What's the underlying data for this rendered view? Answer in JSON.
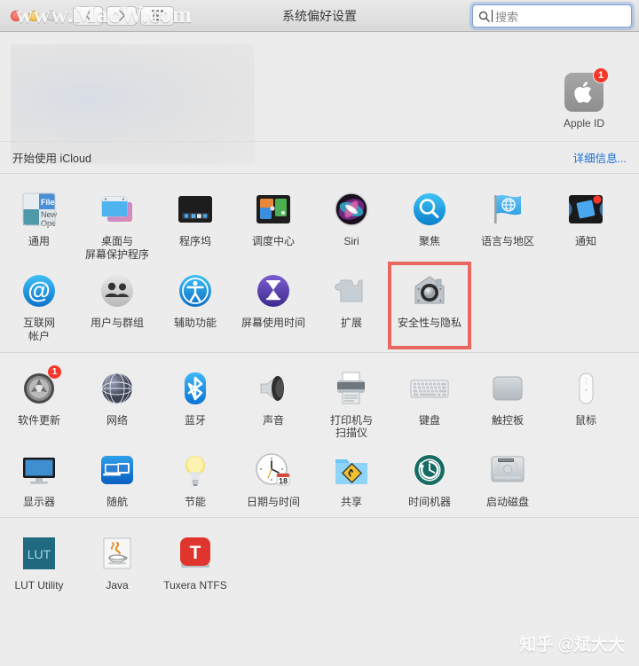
{
  "window": {
    "title": "系统偏好设置",
    "traffic_lights": [
      "close",
      "minimize",
      "zoom"
    ],
    "nav": {
      "back": "‹",
      "forward": "›",
      "show_all": "show-all-grid"
    }
  },
  "search": {
    "placeholder": "搜索",
    "value": "",
    "icon": "search-icon"
  },
  "watermarks": {
    "top": "www.MacW.com",
    "bottom": "知乎 @斌大大"
  },
  "icloud_banner": {
    "start_text": "开始使用 iCloud",
    "details_link": "详细信息...",
    "apple_id": {
      "label": "Apple ID",
      "badge": "1",
      "icon": "apple-logo-icon"
    }
  },
  "accent_colors": {
    "highlight_box": "#e8685f",
    "badge_red": "#f5382b",
    "link_blue": "#1a6fd4",
    "focus_ring": "#7f9fd4"
  },
  "sections": [
    {
      "name": "personal",
      "rows": [
        [
          {
            "label": "通用",
            "icon": "general-icon",
            "highlighted": false
          },
          {
            "label": "桌面与\n屏幕保护程序",
            "icon": "desktop-screensaver-icon",
            "highlighted": false
          },
          {
            "label": "程序坞",
            "icon": "dock-icon",
            "highlighted": false
          },
          {
            "label": "调度中心",
            "icon": "mission-control-icon",
            "highlighted": false
          },
          {
            "label": "Siri",
            "icon": "siri-icon",
            "highlighted": false
          },
          {
            "label": "聚焦",
            "icon": "spotlight-icon",
            "highlighted": false
          },
          {
            "label": "语言与地区",
            "icon": "language-region-icon",
            "highlighted": false
          },
          {
            "label": "通知",
            "icon": "notifications-icon",
            "highlighted": false
          }
        ],
        [
          {
            "label": "互联网\n帐户",
            "icon": "internet-accounts-icon",
            "highlighted": false
          },
          {
            "label": "用户与群组",
            "icon": "users-groups-icon",
            "highlighted": false
          },
          {
            "label": "辅助功能",
            "icon": "accessibility-icon",
            "highlighted": false
          },
          {
            "label": "屏幕使用时间",
            "icon": "screen-time-icon",
            "highlighted": false
          },
          {
            "label": "扩展",
            "icon": "extensions-icon",
            "highlighted": false
          },
          {
            "label": "安全性与隐私",
            "icon": "security-privacy-icon",
            "highlighted": true
          }
        ]
      ]
    },
    {
      "name": "hardware",
      "rows": [
        [
          {
            "label": "软件更新",
            "icon": "software-update-icon",
            "badge": "1",
            "highlighted": false
          },
          {
            "label": "网络",
            "icon": "network-icon",
            "highlighted": false
          },
          {
            "label": "蓝牙",
            "icon": "bluetooth-icon",
            "highlighted": false
          },
          {
            "label": "声音",
            "icon": "sound-icon",
            "highlighted": false
          },
          {
            "label": "打印机与\n扫描仪",
            "icon": "printers-scanners-icon",
            "highlighted": false
          },
          {
            "label": "键盘",
            "icon": "keyboard-icon",
            "highlighted": false
          },
          {
            "label": "触控板",
            "icon": "trackpad-icon",
            "highlighted": false
          },
          {
            "label": "鼠标",
            "icon": "mouse-icon",
            "highlighted": false
          }
        ],
        [
          {
            "label": "显示器",
            "icon": "displays-icon",
            "highlighted": false
          },
          {
            "label": "随航",
            "icon": "sidecar-icon",
            "highlighted": false
          },
          {
            "label": "节能",
            "icon": "energy-saver-icon",
            "highlighted": false
          },
          {
            "label": "日期与时间",
            "icon": "date-time-icon",
            "highlighted": false
          },
          {
            "label": "共享",
            "icon": "sharing-icon",
            "highlighted": false
          },
          {
            "label": "时间机器",
            "icon": "time-machine-icon",
            "highlighted": false
          },
          {
            "label": "启动磁盘",
            "icon": "startup-disk-icon",
            "highlighted": false
          }
        ]
      ]
    },
    {
      "name": "third-party",
      "rows": [
        [
          {
            "label": "LUT Utility",
            "icon": "lut-utility-icon",
            "highlighted": false
          },
          {
            "label": "Java",
            "icon": "java-icon",
            "highlighted": false
          },
          {
            "label": "Tuxera NTFS",
            "icon": "tuxera-ntfs-icon",
            "highlighted": false
          }
        ]
      ]
    }
  ]
}
